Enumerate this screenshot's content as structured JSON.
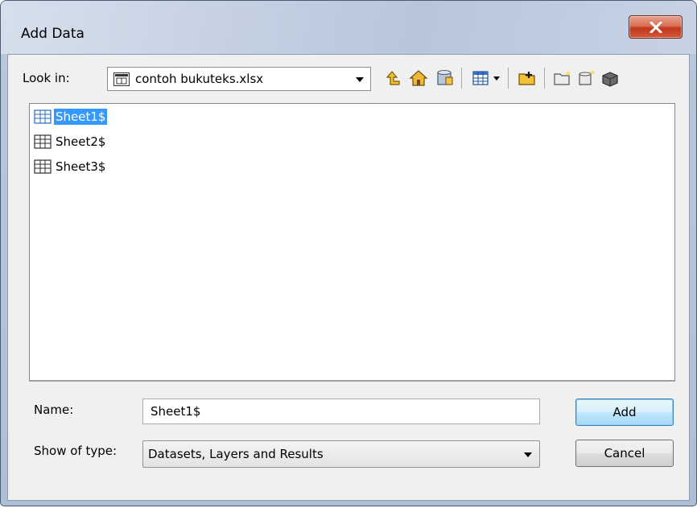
{
  "window": {
    "title": "Add Data",
    "close_glyph": "X"
  },
  "look_in": {
    "label": "Look in:",
    "value": "contoh bukuteks.xlsx"
  },
  "toolbar": {
    "icons": [
      "up-one-level-icon",
      "home-icon",
      "catalog-icon",
      "view-menu-icon",
      "connect-folder-icon",
      "new-folder-icon",
      "new-geodatabase-icon",
      "new-toolbox-icon"
    ]
  },
  "files": [
    {
      "name": "Sheet1$",
      "selected": true
    },
    {
      "name": "Sheet2$",
      "selected": false
    },
    {
      "name": "Sheet3$",
      "selected": false
    }
  ],
  "name_field": {
    "label": "Name:",
    "value": "Sheet1$"
  },
  "type_field": {
    "label": "Show of type:",
    "value": "Datasets, Layers and Results"
  },
  "buttons": {
    "add": "Add",
    "cancel": "Cancel"
  },
  "colors": {
    "selection": "#3399ff",
    "close_button": "#c0381c"
  }
}
